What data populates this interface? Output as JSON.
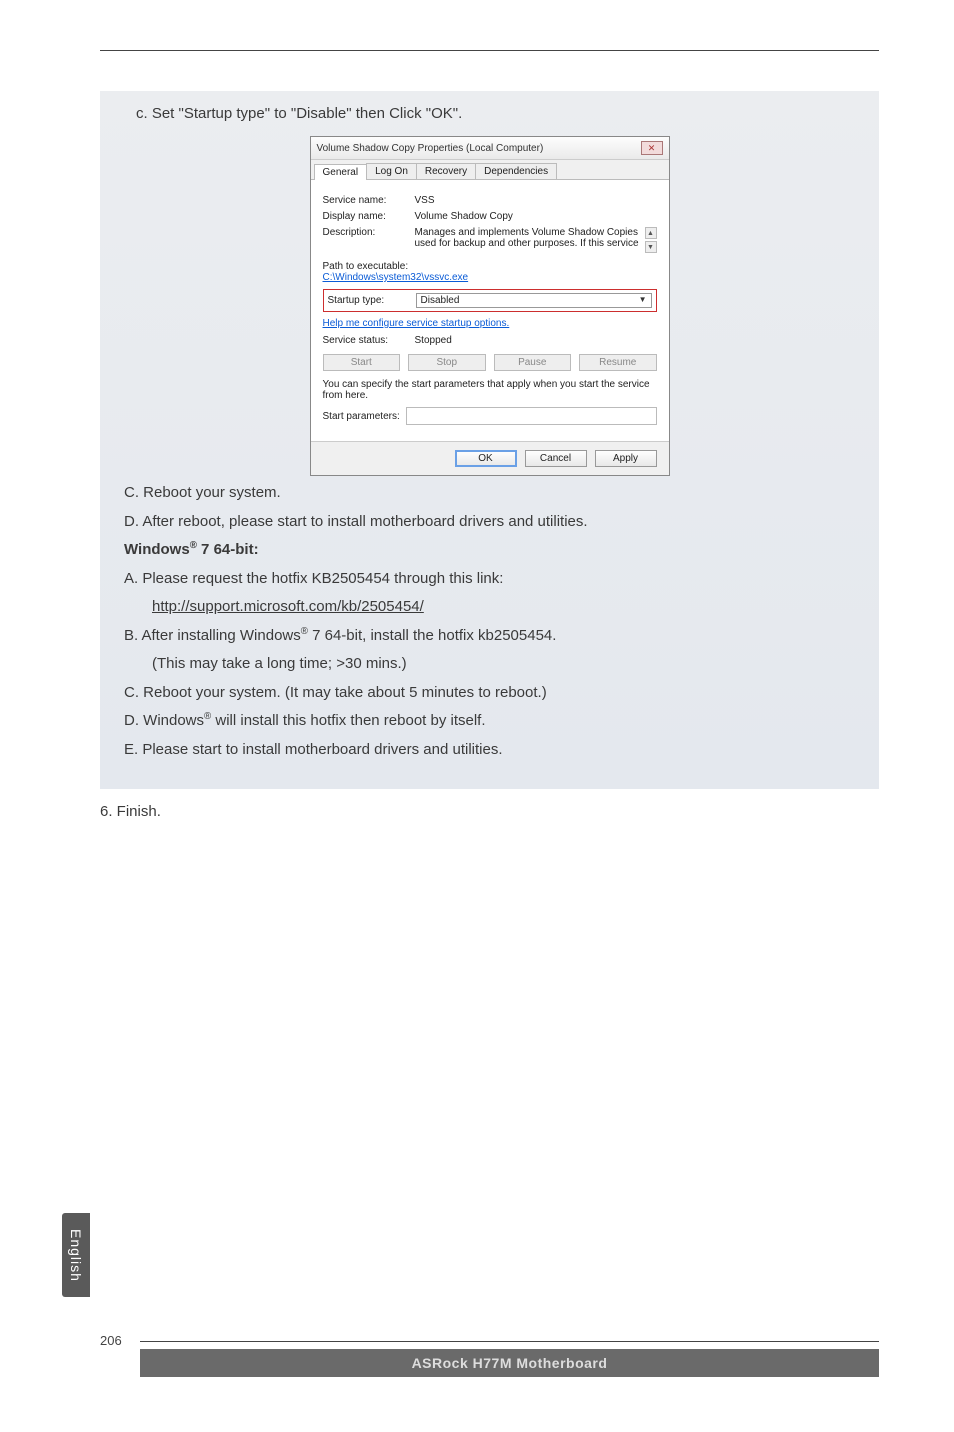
{
  "caption": "c. Set \"Startup type\" to \"Disable\" then Click \"OK\".",
  "dialog": {
    "title": "Volume Shadow Copy Properties (Local Computer)",
    "close_glyph": "✕",
    "tabs": {
      "general": "General",
      "logon": "Log On",
      "recovery": "Recovery",
      "deps": "Dependencies"
    },
    "service_name_lbl": "Service name:",
    "service_name_val": "VSS",
    "display_name_lbl": "Display name:",
    "display_name_val": "Volume Shadow Copy",
    "description_lbl": "Description:",
    "description_val": "Manages and implements Volume Shadow Copies used for backup and other purposes. If this service",
    "path_lbl": "Path to executable:",
    "path_val": "C:\\Windows\\system32\\vssvc.exe",
    "startup_lbl": "Startup type:",
    "startup_val": "Disabled",
    "help_link": "Help me configure service startup options.",
    "status_lbl": "Service status:",
    "status_val": "Stopped",
    "btns": {
      "start": "Start",
      "stop": "Stop",
      "pause": "Pause",
      "resume": "Resume"
    },
    "specify_text": "You can specify the start parameters that apply when you start the service from here.",
    "start_params_lbl": "Start parameters:",
    "ok": "OK",
    "cancel": "Cancel",
    "apply": "Apply"
  },
  "list": {
    "c": "C. Reboot your system.",
    "d": "D. After reboot, please start to install motherboard drivers and utilities.",
    "win_heading_pre": "Windows",
    "win_heading_post": " 7 64-bit:",
    "a1": "A. Please request the hotfix KB2505454 through this link:",
    "a2": "http://support.microsoft.com/kb/2505454/",
    "b1_pre": "B. After installing Windows",
    "b1_post": " 7 64-bit, install the hotfix kb2505454.",
    "b2": "(This may take a long time; >30 mins.)",
    "c2": "C. Reboot your system. (It may take about 5 minutes to reboot.)",
    "d2_pre": "D. Windows",
    "d2_post": " will install this hotfix then reboot by itself.",
    "e": "E. Please start to install motherboard drivers and utilities.",
    "six": "6. Finish."
  },
  "side_tab": "English",
  "page_number": "206",
  "footer": "ASRock  H77M  Motherboard"
}
